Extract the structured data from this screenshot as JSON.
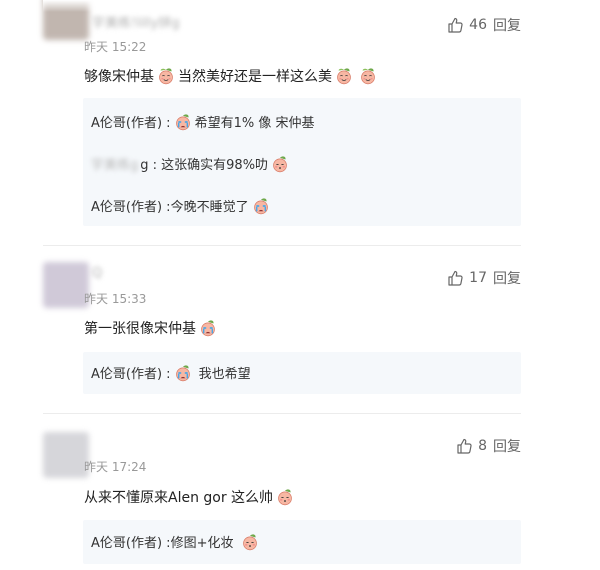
{
  "colors": {
    "accent": "#f5f8fb",
    "text": "#222222",
    "muted": "#999999",
    "divider": "#ececec"
  },
  "comments": [
    {
      "username": "宇美练!lilly拼g",
      "time": "昨天 15:22",
      "likes": "46",
      "reply_label": "回复",
      "content_a": "够像宋仲基",
      "content_b": "当然美好还是一样这么美",
      "replies": [
        {
          "author": "A伦哥(作者) : ",
          "text": "希望有1% 像 宋仲基"
        },
        {
          "blurred": "宇美练g",
          "text": "g : 这张确实有98%叻"
        },
        {
          "author": "A伦哥(作者) : ",
          "text": "今晚不睡觉了"
        }
      ]
    },
    {
      "username": "Q",
      "time": "昨天 15:33",
      "likes": "17",
      "reply_label": "回复",
      "content_a": "第一张很像宋仲基",
      "replies": [
        {
          "author": "A伦哥(作者) : ",
          "text": "我也希望"
        }
      ]
    },
    {
      "username": "",
      "time": "昨天 17:24",
      "likes": "8",
      "reply_label": "回复",
      "content_a": "从来不懂原来Alen gor 这么帅",
      "replies": [
        {
          "author": "A伦哥(作者) : ",
          "text": "修图+化妆"
        }
      ]
    }
  ],
  "icons": {
    "like": "thumbs-up-icon",
    "emoji_smirk": "smirk-emoji-icon",
    "emoji_cry": "crying-emoji-icon",
    "emoji_shy": "shy-emoji-icon"
  }
}
